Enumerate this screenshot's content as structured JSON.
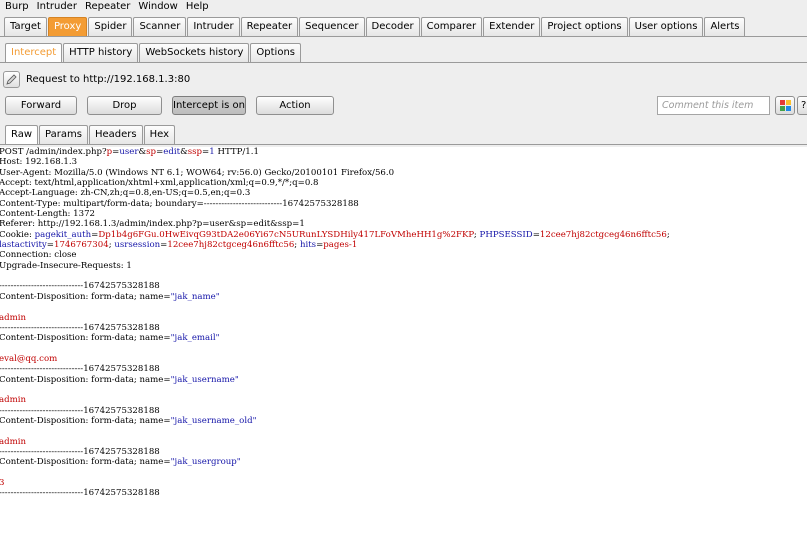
{
  "menu": [
    "Burp",
    "Intruder",
    "Repeater",
    "Window",
    "Help"
  ],
  "main_tabs": [
    "Target",
    "Proxy",
    "Spider",
    "Scanner",
    "Intruder",
    "Repeater",
    "Sequencer",
    "Decoder",
    "Comparer",
    "Extender",
    "Project options",
    "User options",
    "Alerts"
  ],
  "proxy_tabs": [
    "Intercept",
    "HTTP history",
    "WebSockets history",
    "Options"
  ],
  "request_label": "Request to http://192.168.1.3:80",
  "buttons": {
    "forward": "Forward",
    "drop": "Drop",
    "intercept": "Intercept is on",
    "action": "Action"
  },
  "comment_placeholder": "Comment this item",
  "help_label": "?",
  "editor_tabs": [
    "Raw",
    "Params",
    "Headers",
    "Hex"
  ],
  "colors": {
    "accent": "#f39c34",
    "param_name": "#c00000",
    "param_value": "#1414a8"
  },
  "request_lines": [
    [
      {
        "t": "POST /admin/index.php?"
      },
      {
        "t": "p",
        "c": "pn"
      },
      {
        "t": "="
      },
      {
        "t": "user",
        "c": "pv"
      },
      {
        "t": "&"
      },
      {
        "t": "sp",
        "c": "pn"
      },
      {
        "t": "="
      },
      {
        "t": "edit",
        "c": "pv"
      },
      {
        "t": "&"
      },
      {
        "t": "ssp",
        "c": "pn"
      },
      {
        "t": "="
      },
      {
        "t": "1",
        "c": "pv"
      },
      {
        "t": " HTTP/1.1"
      }
    ],
    [
      {
        "t": "Host: 192.168.1.3"
      }
    ],
    [
      {
        "t": "User-Agent: Mozilla/5.0 (Windows NT 6.1; WOW64; rv:56.0) Gecko/20100101 Firefox/56.0"
      }
    ],
    [
      {
        "t": "Accept: text/html,application/xhtml+xml,application/xml;q=0.9,*/*;q=0.8"
      }
    ],
    [
      {
        "t": "Accept-Language: zh-CN,zh;q=0.8,en-US;q=0.5,en;q=0.3"
      }
    ],
    [
      {
        "t": "Content-Type: multipart/form-data; boundary=---------------------------16742575328188"
      }
    ],
    [
      {
        "t": "Content-Length: 1372"
      }
    ],
    [
      {
        "t": "Referer: http://192.168.1.3/admin/index.php?p=user&sp=edit&ssp=1"
      }
    ],
    [
      {
        "t": "Cookie: "
      },
      {
        "t": "pagekit_auth",
        "c": "pv"
      },
      {
        "t": "="
      },
      {
        "t": "Dp1b4g6FGu.0HwEivqG93tDA2e06Yi67cN5URunLYSDHily417LFoVMheHH1g%2FKP",
        "c": "pn"
      },
      {
        "t": "; "
      },
      {
        "t": "PHPSESSID",
        "c": "pv"
      },
      {
        "t": "="
      },
      {
        "t": "12cee7hj82ctgceg46n6fftc56",
        "c": "pn"
      },
      {
        "t": ";"
      }
    ],
    [
      {
        "t": "lastactivity",
        "c": "pv"
      },
      {
        "t": "="
      },
      {
        "t": "1746767304",
        "c": "pn"
      },
      {
        "t": "; "
      },
      {
        "t": "usrsession",
        "c": "pv"
      },
      {
        "t": "="
      },
      {
        "t": "12cee7hj82ctgceg46n6fftc56",
        "c": "pn"
      },
      {
        "t": "; "
      },
      {
        "t": "hits",
        "c": "pv"
      },
      {
        "t": "="
      },
      {
        "t": "pages-1",
        "c": "pn"
      }
    ],
    [
      {
        "t": "Connection: close"
      }
    ],
    [
      {
        "t": "Upgrade-Insecure-Requests: 1"
      }
    ],
    [
      {
        "t": ""
      }
    ],
    [
      {
        "t": "-----------------------------16742575328188"
      }
    ],
    [
      {
        "t": "Content-Disposition: form-data; name="
      },
      {
        "t": "\"jak_name\"",
        "c": "dq"
      }
    ],
    [
      {
        "t": ""
      }
    ],
    [
      {
        "t": "admin",
        "c": "pn"
      }
    ],
    [
      {
        "t": "-----------------------------16742575328188"
      }
    ],
    [
      {
        "t": "Content-Disposition: form-data; name="
      },
      {
        "t": "\"jak_email\"",
        "c": "dq"
      }
    ],
    [
      {
        "t": ""
      }
    ],
    [
      {
        "t": "eval@qq.com",
        "c": "pn"
      }
    ],
    [
      {
        "t": "-----------------------------16742575328188"
      }
    ],
    [
      {
        "t": "Content-Disposition: form-data; name="
      },
      {
        "t": "\"jak_username\"",
        "c": "dq"
      }
    ],
    [
      {
        "t": ""
      }
    ],
    [
      {
        "t": "admin",
        "c": "pn"
      }
    ],
    [
      {
        "t": "-----------------------------16742575328188"
      }
    ],
    [
      {
        "t": "Content-Disposition: form-data; name="
      },
      {
        "t": "\"jak_username_old\"",
        "c": "dq"
      }
    ],
    [
      {
        "t": ""
      }
    ],
    [
      {
        "t": "admin",
        "c": "pn"
      }
    ],
    [
      {
        "t": "-----------------------------16742575328188"
      }
    ],
    [
      {
        "t": "Content-Disposition: form-data; name="
      },
      {
        "t": "\"jak_usergroup\"",
        "c": "dq"
      }
    ],
    [
      {
        "t": ""
      }
    ],
    [
      {
        "t": "3",
        "c": "pn"
      }
    ],
    [
      {
        "t": "-----------------------------16742575328188"
      }
    ]
  ]
}
